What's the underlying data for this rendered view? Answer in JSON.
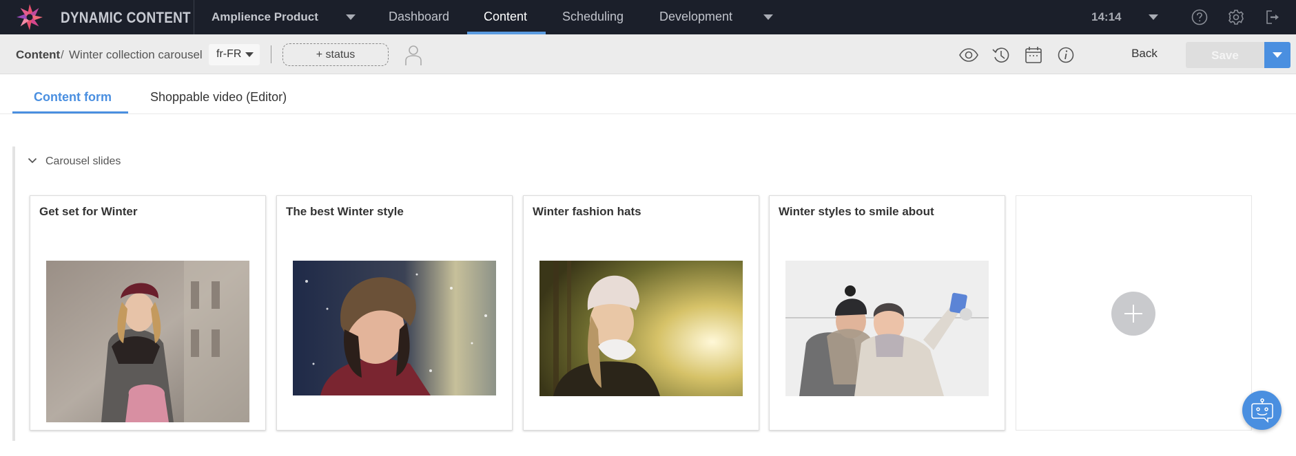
{
  "topbar": {
    "brand": "DYNAMIC CONTENT",
    "hub": "Amplience Product",
    "nav": [
      {
        "label": "Dashboard",
        "active": false
      },
      {
        "label": "Content",
        "active": true
      },
      {
        "label": "Scheduling",
        "active": false
      },
      {
        "label": "Development",
        "active": false
      }
    ],
    "time": "14:14",
    "icons": [
      "help-icon",
      "settings-icon",
      "logout-icon"
    ]
  },
  "subbar": {
    "breadcrumb_root": "Content",
    "breadcrumb_sep": "/",
    "breadcrumb_item": "Winter collection carousel",
    "locale": "fr-FR",
    "status_label": "+ status",
    "icons": [
      "preview-icon",
      "history-icon",
      "calendar-icon",
      "info-icon"
    ],
    "back_label": "Back",
    "save_label": "Save"
  },
  "tabs": [
    {
      "label": "Content form",
      "active": true
    },
    {
      "label": "Shoppable video (Editor)",
      "active": false
    }
  ],
  "section": {
    "title": "Carousel slides",
    "expanded": true
  },
  "cards": [
    {
      "title": "Get set for Winter",
      "image": "woman in beret and grey coat holding pink handbag"
    },
    {
      "title": "The best Winter style",
      "image": "woman in knit hat in snowfall"
    },
    {
      "title": "Winter fashion hats",
      "image": "woman in white knit hat in sunlit forest"
    },
    {
      "title": "Winter styles to smile about",
      "image": "couple taking selfie in snow"
    }
  ],
  "colors": {
    "topbar_bg": "#1b1f2a",
    "accent": "#4a8fe0",
    "subbar_bg": "#ececec"
  }
}
